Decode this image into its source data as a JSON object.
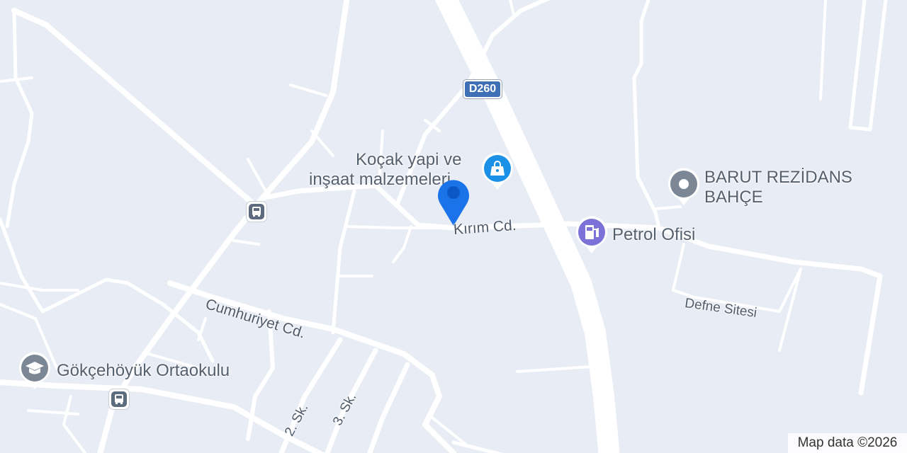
{
  "map": {
    "attribution": "Map data ©2026",
    "route_shield": "D260",
    "pois": [
      {
        "id": "kocak",
        "name_line1": "Koçak yapi ve",
        "name_line2": "inşaat malzemeleri",
        "icon": "shopping-bag-icon",
        "color": "#1a91e6"
      },
      {
        "id": "barut",
        "name_line1": "BARUT REZİDANS",
        "name_line2": "BAHÇE",
        "icon": "place-icon",
        "color": "#7b8794"
      },
      {
        "id": "petrol",
        "name": "Petrol Ofisi",
        "icon": "gas-station-icon",
        "color": "#7b71d7"
      },
      {
        "id": "gokcehoyuk",
        "name": "Gökçehöyük Ortaokulu",
        "icon": "school-icon",
        "color": "#7b8794"
      }
    ],
    "streets": {
      "kirim": "Kırım Cd.",
      "cumhuriyet": "Cumhuriyet Cd.",
      "defne": "Defne Sitesi",
      "sk2": "2. Sk.",
      "sk3": "3. Sk."
    },
    "bus_stops": [
      "bus-stop-icon",
      "bus-stop-icon"
    ],
    "colors": {
      "background": "#e8ecf4",
      "road": "#ffffff",
      "pin": "#1a73e8",
      "shield": "#3f6fb5"
    }
  }
}
